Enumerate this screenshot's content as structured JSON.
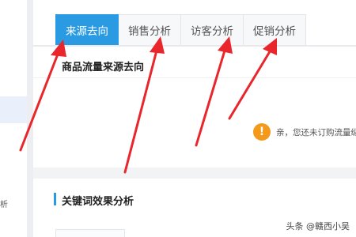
{
  "tabs": [
    {
      "label": "来源去向",
      "active": true
    },
    {
      "label": "销售分析",
      "active": false
    },
    {
      "label": "访客分析",
      "active": false
    },
    {
      "label": "促销分析",
      "active": false
    }
  ],
  "traffic_section": {
    "title": "商品流量来源去向",
    "notice_icon": "!",
    "notice_text": "亲，您还未订购流量纵"
  },
  "keyword_section": {
    "title": "关键词效果分析"
  },
  "sidebar": {
    "partial_text": "析"
  },
  "watermark": "头条 @赣西小吴",
  "colors": {
    "accent": "#2a9be2",
    "arrow": "#e8262b",
    "notice": "#f39a1b"
  }
}
